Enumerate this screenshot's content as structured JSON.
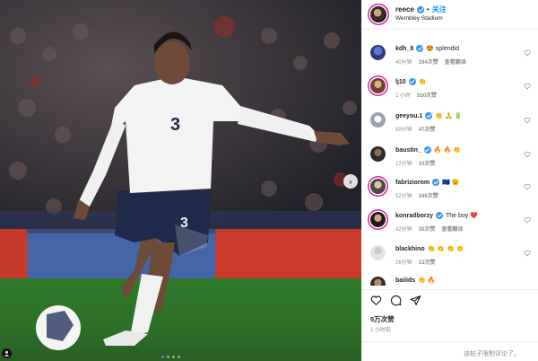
{
  "post": {
    "username": "reece",
    "separator": "•",
    "follow_label": "关注",
    "location": "Wembley Stadium",
    "likes_label": "5万次赞",
    "posted_ago": "1 小时前",
    "comments_limited_notice": "该帖子限制评论了。"
  },
  "media": {
    "jersey_number": "3",
    "carousel_dots": 4,
    "active_dot": 1
  },
  "comments": [
    {
      "user": "kdh_8",
      "text": "😍 splendid",
      "time": "40分钟",
      "likes": "194次赞",
      "translate": "查看翻译"
    },
    {
      "user": "lj10",
      "text": "👏",
      "time": "1 小时",
      "likes": "550次赞",
      "translate": ""
    },
    {
      "user": "geeyou.1",
      "text": "👏 🙏 🔋",
      "time": "59分钟",
      "likes": "47次赞",
      "translate": ""
    },
    {
      "user": "baustin_",
      "text": "🔥 🔥 👏",
      "time": "12分钟",
      "likes": "10次赞",
      "translate": ""
    },
    {
      "user": "fabriziorom",
      "text": "🇪🇺 😉",
      "time": "52分钟",
      "likes": "346次赞",
      "translate": ""
    },
    {
      "user": "konradborzy",
      "text": "The boy ❤️",
      "time": "42分钟",
      "likes": "30次赞",
      "translate": "查看翻译"
    },
    {
      "user": "blackhino",
      "text": "👏 👏 👏 👏",
      "time": "26分钟",
      "likes": "13次赞",
      "translate": ""
    },
    {
      "user": "baiiids",
      "text": "👏 🔥",
      "time": "",
      "likes": "",
      "translate": ""
    }
  ],
  "colors": {
    "verified": "#3897f0",
    "link": "#0095f6",
    "muted": "#8e8e8e",
    "text": "#262626",
    "story_ring": "#d6249f"
  },
  "icons": {
    "like": "heart-icon",
    "comment": "comment-icon",
    "share": "send-icon",
    "next": "chevron-right-icon",
    "tag": "user-tag-icon"
  }
}
